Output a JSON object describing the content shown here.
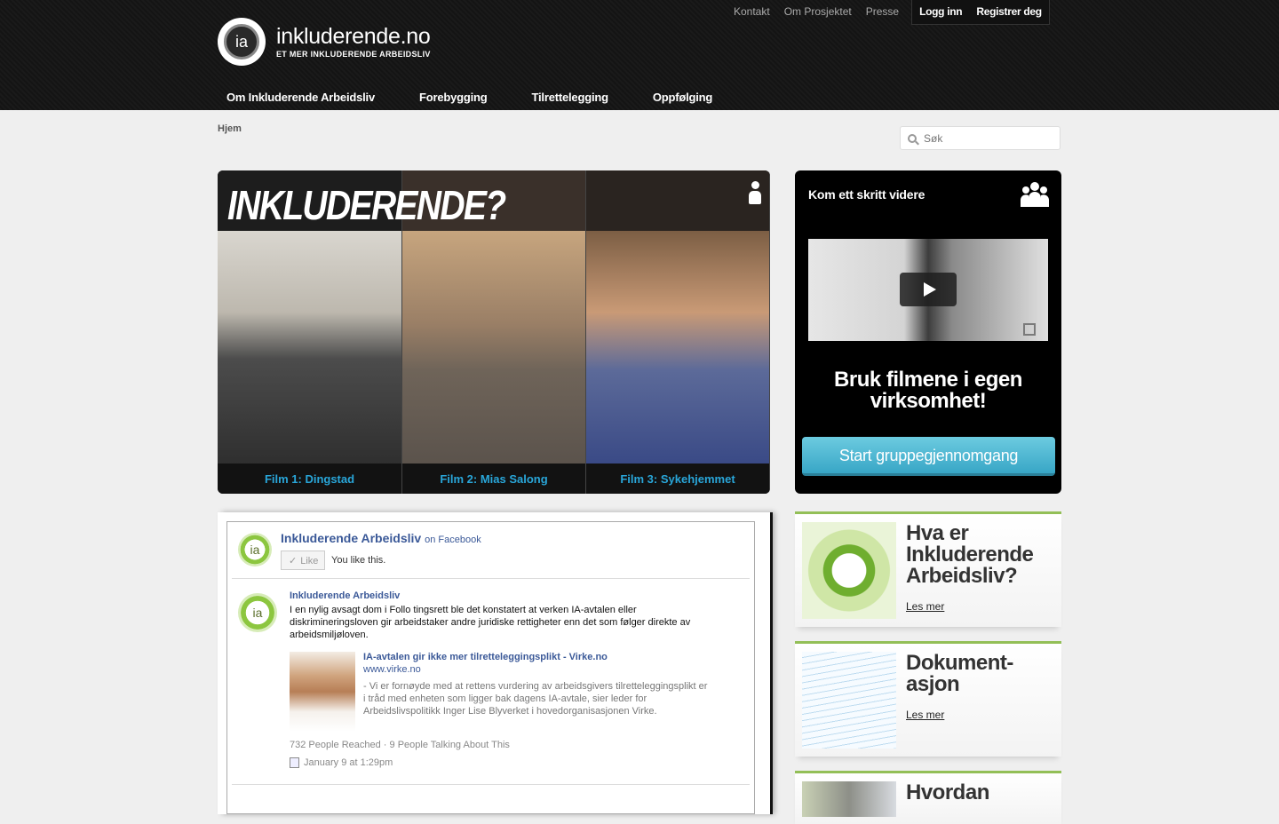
{
  "header": {
    "logo_name": "inkluderende.no",
    "logo_tagline": "ET MER INKLUDERENDE ARBEIDSLIV",
    "logo_mark": "ia",
    "top_links": [
      "Kontakt",
      "Om Prosjektet",
      "Presse"
    ],
    "login_label": "Logg inn",
    "register_label": "Registrer deg",
    "main_nav": [
      "Om Inkluderende Arbeidsliv",
      "Forebygging",
      "Tilrettelegging",
      "Oppfølging"
    ]
  },
  "breadcrumb": "Hjem",
  "search": {
    "placeholder": "Søk",
    "icon": "search-icon"
  },
  "films": {
    "title": "INKLUDERENDE?",
    "items": [
      {
        "caption": "Film 1: Dingstad"
      },
      {
        "caption": "Film 2: Mias Salong"
      },
      {
        "caption": "Film 3: Sykehjemmet"
      }
    ],
    "caption_color": "#29a6d9"
  },
  "promo": {
    "title": "Kom ett skritt videre",
    "headline": "Bruk filmene i egen virksomhet!",
    "button_label": "Start gruppegjennomgang",
    "button_color": "#4bb5d2"
  },
  "facebook": {
    "page_name": "Inkluderende Arbeidsliv",
    "on_facebook": "on Facebook",
    "like_label": "Like",
    "you_like": "You like this.",
    "avatar_text": "ia",
    "post": {
      "author": "Inkluderende Arbeidsliv",
      "text": "I en nylig avsagt dom i Follo tingsrett ble det konstatert at verken IA-avtalen eller diskrimineringsloven gir arbeidstaker andre juridiske rettigheter enn det som følger direkte av arbeidsmiljøloven.",
      "link_title": "IA-avtalen gir ikke mer tilretteleggingsplikt - Virke.no",
      "link_url": "www.virke.no",
      "link_desc": "- Vi er fornøyde med at rettens vurdering av arbeidsgivers tilretteleggingsplikt er i tråd med enheten som ligger bak dagens IA-avtale, sier leder for Arbeidslivspolitikk Inger Lise Blyverket i hovedorganisasjonen Virke.",
      "reach": "732 People Reached · 9 People Talking About This",
      "date": "January 9 at 1:29pm"
    }
  },
  "cards": [
    {
      "title": "Hva er Inkluderende Arbeidsliv?",
      "link": "Les mer"
    },
    {
      "title": "Dokument-asjon",
      "link": "Les mer"
    },
    {
      "title": "Hvordan",
      "link": ""
    }
  ],
  "accent_green": "#93bf57"
}
